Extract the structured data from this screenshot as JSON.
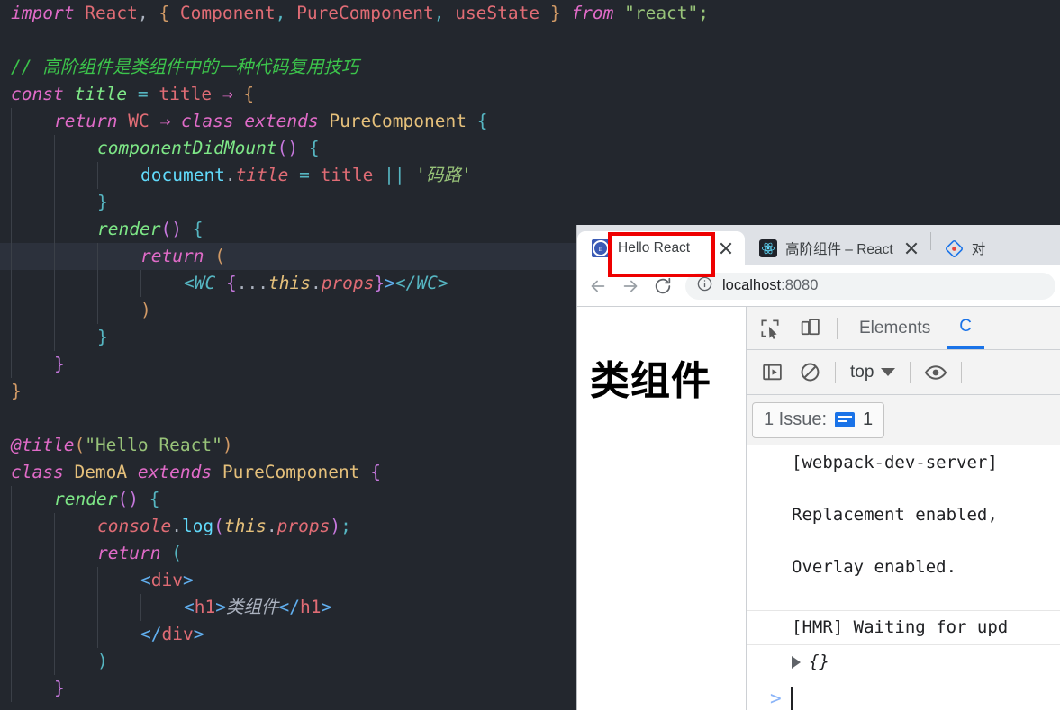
{
  "editor": {
    "language": "javascript",
    "background": "#23272e",
    "highlight_line_background": "#2c313c",
    "lines": [
      {
        "n": 1,
        "indent": 0,
        "highlight": false,
        "tokens": [
          {
            "t": "import",
            "c": "kw"
          },
          {
            "t": " ",
            "c": "plain"
          },
          {
            "t": "React",
            "c": "var"
          },
          {
            "t": ",",
            "c": "plain"
          },
          {
            "t": " ",
            "c": "plain"
          },
          {
            "t": "{",
            "c": "pun-o"
          },
          {
            "t": " ",
            "c": "plain"
          },
          {
            "t": "Component",
            "c": "var"
          },
          {
            "t": ",",
            "c": "pun"
          },
          {
            "t": " ",
            "c": "plain"
          },
          {
            "t": "PureComponent",
            "c": "var"
          },
          {
            "t": ",",
            "c": "pun"
          },
          {
            "t": " ",
            "c": "plain"
          },
          {
            "t": "useState",
            "c": "var"
          },
          {
            "t": " ",
            "c": "plain"
          },
          {
            "t": "}",
            "c": "pun-o"
          },
          {
            "t": " ",
            "c": "plain"
          },
          {
            "t": "from",
            "c": "kw"
          },
          {
            "t": " ",
            "c": "plain"
          },
          {
            "t": "\"react\"",
            "c": "str"
          },
          {
            "t": ";",
            "c": "semi"
          }
        ]
      },
      {
        "n": 2,
        "indent": 0,
        "highlight": false,
        "tokens": []
      },
      {
        "n": 3,
        "indent": 0,
        "highlight": false,
        "tokens": [
          {
            "t": "// 高阶组件是类组件中的一种代码复用技巧",
            "c": "cmt"
          }
        ]
      },
      {
        "n": 4,
        "indent": 0,
        "highlight": false,
        "tokens": [
          {
            "t": "const",
            "c": "kw"
          },
          {
            "t": " ",
            "c": "plain"
          },
          {
            "t": "title",
            "c": "fn"
          },
          {
            "t": " ",
            "c": "plain"
          },
          {
            "t": "=",
            "c": "op"
          },
          {
            "t": " ",
            "c": "plain"
          },
          {
            "t": "title",
            "c": "var"
          },
          {
            "t": " ",
            "c": "plain"
          },
          {
            "t": "⇒",
            "c": "kw"
          },
          {
            "t": " ",
            "c": "plain"
          },
          {
            "t": "{",
            "c": "pun-o"
          }
        ]
      },
      {
        "n": 5,
        "indent": 1,
        "highlight": false,
        "tokens": [
          {
            "t": "return",
            "c": "kw"
          },
          {
            "t": " ",
            "c": "plain"
          },
          {
            "t": "WC",
            "c": "var"
          },
          {
            "t": " ",
            "c": "plain"
          },
          {
            "t": "⇒",
            "c": "kw"
          },
          {
            "t": " ",
            "c": "plain"
          },
          {
            "t": "class",
            "c": "kw"
          },
          {
            "t": " ",
            "c": "plain"
          },
          {
            "t": "extends",
            "c": "kw"
          },
          {
            "t": " ",
            "c": "plain"
          },
          {
            "t": "PureComponent",
            "c": "cls"
          },
          {
            "t": " ",
            "c": "plain"
          },
          {
            "t": "{",
            "c": "pun"
          }
        ]
      },
      {
        "n": 6,
        "indent": 2,
        "highlight": false,
        "tokens": [
          {
            "t": "componentDidMount",
            "c": "fn"
          },
          {
            "t": "()",
            "c": "pun-p"
          },
          {
            "t": " ",
            "c": "plain"
          },
          {
            "t": "{",
            "c": "pun"
          }
        ]
      },
      {
        "n": 7,
        "indent": 3,
        "highlight": false,
        "tokens": [
          {
            "t": "document",
            "c": "fn2"
          },
          {
            "t": ".",
            "c": "plain"
          },
          {
            "t": "title",
            "c": "prop"
          },
          {
            "t": " ",
            "c": "plain"
          },
          {
            "t": "=",
            "c": "op"
          },
          {
            "t": " ",
            "c": "plain"
          },
          {
            "t": "title",
            "c": "var"
          },
          {
            "t": " ",
            "c": "plain"
          },
          {
            "t": "||",
            "c": "op"
          },
          {
            "t": " ",
            "c": "plain"
          },
          {
            "t": "'码路'",
            "c": "str2"
          }
        ]
      },
      {
        "n": 8,
        "indent": 2,
        "highlight": false,
        "tokens": [
          {
            "t": "}",
            "c": "pun"
          }
        ]
      },
      {
        "n": 9,
        "indent": 2,
        "highlight": false,
        "tokens": [
          {
            "t": "render",
            "c": "fn"
          },
          {
            "t": "()",
            "c": "pun-p"
          },
          {
            "t": " ",
            "c": "plain"
          },
          {
            "t": "{",
            "c": "pun"
          }
        ]
      },
      {
        "n": 10,
        "indent": 3,
        "highlight": true,
        "tokens": [
          {
            "t": "return",
            "c": "kw"
          },
          {
            "t": " ",
            "c": "plain"
          },
          {
            "t": "(",
            "c": "pun-o"
          }
        ]
      },
      {
        "n": 11,
        "indent": 4,
        "highlight": false,
        "tokens": [
          {
            "t": "<WC",
            "c": "wc"
          },
          {
            "t": " ",
            "c": "plain"
          },
          {
            "t": "{",
            "c": "pun-p"
          },
          {
            "t": "...",
            "c": "plain"
          },
          {
            "t": "this",
            "c": "this"
          },
          {
            "t": ".",
            "c": "plain"
          },
          {
            "t": "props",
            "c": "prop"
          },
          {
            "t": "}",
            "c": "pun-p"
          },
          {
            "t": ">",
            "c": "tagb"
          },
          {
            "t": "</WC>",
            "c": "wc"
          }
        ]
      },
      {
        "n": 12,
        "indent": 3,
        "highlight": false,
        "tokens": [
          {
            "t": ")",
            "c": "pun-o"
          }
        ]
      },
      {
        "n": 13,
        "indent": 2,
        "highlight": false,
        "tokens": [
          {
            "t": "}",
            "c": "pun"
          }
        ]
      },
      {
        "n": 14,
        "indent": 1,
        "highlight": false,
        "tokens": [
          {
            "t": "}",
            "c": "pun-p"
          }
        ]
      },
      {
        "n": 15,
        "indent": 0,
        "highlight": false,
        "tokens": [
          {
            "t": "}",
            "c": "pun-o"
          }
        ]
      },
      {
        "n": 16,
        "indent": 0,
        "highlight": false,
        "tokens": []
      },
      {
        "n": 17,
        "indent": 0,
        "highlight": false,
        "tokens": [
          {
            "t": "@title",
            "c": "kw"
          },
          {
            "t": "(",
            "c": "pun-o"
          },
          {
            "t": "\"Hello React\"",
            "c": "str"
          },
          {
            "t": ")",
            "c": "pun-o"
          }
        ]
      },
      {
        "n": 18,
        "indent": 0,
        "highlight": false,
        "tokens": [
          {
            "t": "class",
            "c": "kw"
          },
          {
            "t": " ",
            "c": "plain"
          },
          {
            "t": "DemoA",
            "c": "cls"
          },
          {
            "t": " ",
            "c": "plain"
          },
          {
            "t": "extends",
            "c": "kw"
          },
          {
            "t": " ",
            "c": "plain"
          },
          {
            "t": "PureComponent",
            "c": "cls"
          },
          {
            "t": " ",
            "c": "plain"
          },
          {
            "t": "{",
            "c": "pun-p"
          }
        ]
      },
      {
        "n": 19,
        "indent": 1,
        "highlight": false,
        "tokens": [
          {
            "t": "render",
            "c": "fn"
          },
          {
            "t": "()",
            "c": "pun-p"
          },
          {
            "t": " ",
            "c": "plain"
          },
          {
            "t": "{",
            "c": "pun"
          }
        ]
      },
      {
        "n": 20,
        "indent": 2,
        "highlight": false,
        "tokens": [
          {
            "t": "console",
            "c": "prop"
          },
          {
            "t": ".",
            "c": "plain"
          },
          {
            "t": "log",
            "c": "fn2"
          },
          {
            "t": "(",
            "c": "pun-p"
          },
          {
            "t": "this",
            "c": "this"
          },
          {
            "t": ".",
            "c": "plain"
          },
          {
            "t": "props",
            "c": "prop"
          },
          {
            "t": ")",
            "c": "pun-p"
          },
          {
            "t": ";",
            "c": "pun"
          }
        ]
      },
      {
        "n": 21,
        "indent": 2,
        "highlight": false,
        "tokens": [
          {
            "t": "return",
            "c": "kw"
          },
          {
            "t": " ",
            "c": "plain"
          },
          {
            "t": "(",
            "c": "pun"
          }
        ]
      },
      {
        "n": 22,
        "indent": 3,
        "highlight": false,
        "tokens": [
          {
            "t": "<",
            "c": "tagb"
          },
          {
            "t": "div",
            "c": "tag"
          },
          {
            "t": ">",
            "c": "tagb"
          }
        ]
      },
      {
        "n": 23,
        "indent": 4,
        "highlight": false,
        "tokens": [
          {
            "t": "<",
            "c": "tagb"
          },
          {
            "t": "h1",
            "c": "tag"
          },
          {
            "t": ">",
            "c": "tagb"
          },
          {
            "t": "类组件",
            "c": "cn"
          },
          {
            "t": "</",
            "c": "tagb"
          },
          {
            "t": "h1",
            "c": "tag"
          },
          {
            "t": ">",
            "c": "tagb"
          }
        ]
      },
      {
        "n": 24,
        "indent": 3,
        "highlight": false,
        "tokens": [
          {
            "t": "</",
            "c": "tagb"
          },
          {
            "t": "div",
            "c": "tag"
          },
          {
            "t": ">",
            "c": "tagb"
          }
        ]
      },
      {
        "n": 25,
        "indent": 2,
        "highlight": false,
        "tokens": [
          {
            "t": ")",
            "c": "pun"
          }
        ]
      },
      {
        "n": 26,
        "indent": 1,
        "highlight": false,
        "tokens": [
          {
            "t": "}",
            "c": "pun-p"
          }
        ]
      }
    ]
  },
  "browser": {
    "tabs": [
      {
        "title": "Hello React",
        "favicon": "globe-blue-icon",
        "active": true,
        "has_close": true
      },
      {
        "title": "高阶组件 – React",
        "favicon": "react-atom-icon",
        "active": false,
        "has_close": true
      },
      {
        "title": "对",
        "favicon": "diamond-blue-icon",
        "active": false,
        "has_close": false
      }
    ],
    "annotation": {
      "color": "#ee0000",
      "target": "Hello React"
    },
    "nav": {
      "back_label": "back-arrow",
      "forward_label": "forward-arrow",
      "reload_label": "reload",
      "url_host": "localhost",
      "url_port": ":8080",
      "info_icon": "info-circle-icon"
    },
    "page": {
      "heading": "类组件"
    }
  },
  "devtools": {
    "tabs": [
      {
        "label": "Elements",
        "active": false
      },
      {
        "label": "C",
        "active": true
      }
    ],
    "toolbar_icons": [
      "inspect-element-icon",
      "device-toolbar-icon",
      "console-sidebar-icon",
      "clear-console-icon",
      "eye-icon"
    ],
    "context": {
      "value": "top"
    },
    "issues": {
      "label": "1 Issue:",
      "count": "1"
    },
    "console": {
      "rows": [
        {
          "text": "[webpack-dev-server]",
          "kind": "log"
        },
        {
          "text": "Replacement enabled,",
          "kind": "log"
        },
        {
          "text": "Overlay enabled.",
          "kind": "log"
        },
        {
          "text": "[HMR] Waiting for upd",
          "kind": "log"
        }
      ],
      "object_row": "{}",
      "prompt_symbol": ">"
    }
  }
}
